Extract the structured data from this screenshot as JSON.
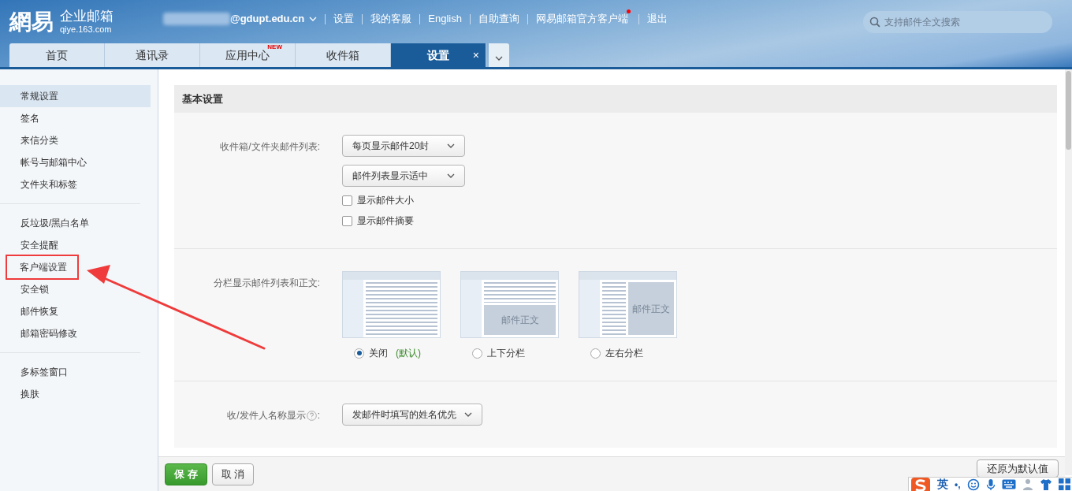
{
  "logo": {
    "mark": "網易",
    "name": "企业邮箱",
    "domain": "qiye.163.com"
  },
  "account": {
    "email": "@gdupt.edu.cn"
  },
  "top_links": [
    {
      "label": "设置",
      "dot": false
    },
    {
      "label": "我的客服",
      "dot": false
    },
    {
      "label": "English",
      "dot": false
    },
    {
      "label": "自助查询",
      "dot": false
    },
    {
      "label": "网易邮箱官方客户端",
      "dot": true
    },
    {
      "label": "退出",
      "dot": false
    }
  ],
  "search": {
    "placeholder": "支持邮件全文搜索"
  },
  "tabs": [
    {
      "label": "首页",
      "selected": false
    },
    {
      "label": "通讯录",
      "selected": false
    },
    {
      "label": "应用中心",
      "selected": false,
      "badge": "NEW"
    },
    {
      "label": "收件箱",
      "selected": false
    },
    {
      "label": "设置",
      "selected": true,
      "close": "×"
    }
  ],
  "sidebar": {
    "groups": [
      [
        {
          "label": "常规设置",
          "selected": true,
          "annotated": false
        },
        {
          "label": "签名",
          "selected": false,
          "annotated": false
        },
        {
          "label": "来信分类",
          "selected": false,
          "annotated": false
        },
        {
          "label": "帐号与邮箱中心",
          "selected": false,
          "annotated": false
        },
        {
          "label": "文件夹和标签",
          "selected": false,
          "annotated": false
        }
      ],
      [
        {
          "label": "反垃圾/黑白名单",
          "selected": false,
          "annotated": false
        },
        {
          "label": "安全提醒",
          "selected": false,
          "annotated": false
        },
        {
          "label": "客户端设置",
          "selected": false,
          "annotated": true
        },
        {
          "label": "安全锁",
          "selected": false,
          "annotated": false
        },
        {
          "label": "邮件恢复",
          "selected": false,
          "annotated": false
        },
        {
          "label": "邮箱密码修改",
          "selected": false,
          "annotated": false
        }
      ],
      [
        {
          "label": "多标签窗口",
          "selected": false,
          "annotated": false
        },
        {
          "label": "换肤",
          "selected": false,
          "annotated": false
        }
      ]
    ]
  },
  "section": {
    "title": "基本设置",
    "rows": [
      {
        "kind": "list",
        "label": "收件箱/文件夹邮件列表:",
        "selects": [
          "每页显示邮件20封",
          "邮件列表显示适中"
        ],
        "checkboxes": [
          {
            "label": "显示邮件大小",
            "checked": false
          },
          {
            "label": "显示邮件摘要",
            "checked": false
          }
        ]
      },
      {
        "kind": "layout",
        "label": "分栏显示邮件列表和正文:",
        "options": [
          {
            "kind": "off",
            "label": "关闭",
            "note": "(默认)",
            "selected": true
          },
          {
            "kind": "top-bottom",
            "preview_text": "邮件正文",
            "label": "上下分栏",
            "selected": false
          },
          {
            "kind": "left-right",
            "preview_text": "邮件正文",
            "label": "左右分栏",
            "selected": false
          }
        ]
      },
      {
        "kind": "select",
        "label": "收/发件人名称显示",
        "help": true,
        "colon": ":",
        "select": "发邮件时填写的姓名优先"
      }
    ]
  },
  "footer": {
    "save": "保 存",
    "cancel": "取 消",
    "reset": "还原为默认值"
  },
  "ime": {
    "lang": "英",
    "punct": "•,"
  }
}
